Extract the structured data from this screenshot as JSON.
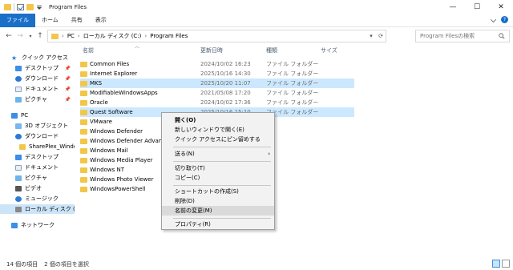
{
  "window": {
    "title": "Program Files",
    "controls": {
      "minimize": "—",
      "maximize": "☐",
      "close": "✕"
    }
  },
  "ribbon": {
    "tabs": [
      "ファイル",
      "ホーム",
      "共有",
      "表示"
    ]
  },
  "addressbar": {
    "crumbs": [
      "PC",
      "ローカル ディスク (C:)",
      "Program Files"
    ],
    "search_placeholder": "Program Filesの検索"
  },
  "sidebar": {
    "items": [
      {
        "label": "クイック アクセス",
        "icon": "star-icon"
      },
      {
        "label": "デスクトップ",
        "icon": "desktop-icon",
        "pinned": true
      },
      {
        "label": "ダウンロード",
        "icon": "download-icon",
        "pinned": true
      },
      {
        "label": "ドキュメント",
        "icon": "document-icon",
        "pinned": true
      },
      {
        "label": "ピクチャ",
        "icon": "picture-icon",
        "pinned": true
      },
      {
        "label": "PC",
        "icon": "pc-icon"
      },
      {
        "label": "3D オブジェクト",
        "icon": "3d-objects-icon"
      },
      {
        "label": "ダウンロード",
        "icon": "download-icon"
      },
      {
        "label": "SharePlex_Windov",
        "icon": "folder-icon"
      },
      {
        "label": "デスクトップ",
        "icon": "desktop-icon"
      },
      {
        "label": "ドキュメント",
        "icon": "document-icon"
      },
      {
        "label": "ピクチャ",
        "icon": "picture-icon"
      },
      {
        "label": "ビデオ",
        "icon": "video-icon"
      },
      {
        "label": "ミュージック",
        "icon": "music-icon"
      },
      {
        "label": "ローカル ディスク (C:)",
        "icon": "drive-icon",
        "selected": true
      },
      {
        "label": "ネットワーク",
        "icon": "network-icon"
      }
    ]
  },
  "columns": {
    "name": "名前",
    "date": "更新日時",
    "type": "種類",
    "size": "サイズ"
  },
  "files": [
    {
      "name": "Common Files",
      "date": "2024/10/02 16:23",
      "type": "ファイル フォルダー"
    },
    {
      "name": "Internet Explorer",
      "date": "2025/10/16 14:30",
      "type": "ファイル フォルダー"
    },
    {
      "name": "MKS",
      "date": "2025/10/20 11:07",
      "type": "ファイル フォルダー",
      "selected": true
    },
    {
      "name": "ModifiableWindowsApps",
      "date": "2021/05/08 17:20",
      "type": "ファイル フォルダー"
    },
    {
      "name": "Oracle",
      "date": "2024/10/02 17:36",
      "type": "ファイル フォルダー"
    },
    {
      "name": "Quest Software",
      "date": "2025/10/16 15:10",
      "type": "ファイル フォルダー",
      "selected": true
    },
    {
      "name": "VMware",
      "date": "",
      "type": ""
    },
    {
      "name": "Windows Defender",
      "date": "",
      "type": ""
    },
    {
      "name": "Windows Defender Advance",
      "date": "",
      "type": ""
    },
    {
      "name": "Windows Mail",
      "date": "",
      "type": ""
    },
    {
      "name": "Windows Media Player",
      "date": "",
      "type": ""
    },
    {
      "name": "Windows NT",
      "date": "",
      "type": ""
    },
    {
      "name": "Windows Photo Viewer",
      "date": "",
      "type": ""
    },
    {
      "name": "WindowsPowerShell",
      "date": "",
      "type": ""
    }
  ],
  "context_menu": {
    "items": [
      {
        "label": "開く(O)",
        "bold": true
      },
      {
        "label": "新しいウィンドウで開く(E)"
      },
      {
        "label": "クイック アクセスにピン留めする"
      },
      {
        "separator": true
      },
      {
        "label": "送る(N)",
        "submenu": true
      },
      {
        "separator": true
      },
      {
        "label": "切り取り(T)"
      },
      {
        "label": "コピー(C)"
      },
      {
        "separator": true
      },
      {
        "label": "ショートカットの作成(S)"
      },
      {
        "label": "削除(D)"
      },
      {
        "label": "名前の変更(M)",
        "highlighted": true
      },
      {
        "separator": true
      },
      {
        "label": "プロパティ(R)"
      }
    ]
  },
  "statusbar": {
    "item_count": "14 個の項目",
    "selected_count": "2 個の項目を選択"
  }
}
